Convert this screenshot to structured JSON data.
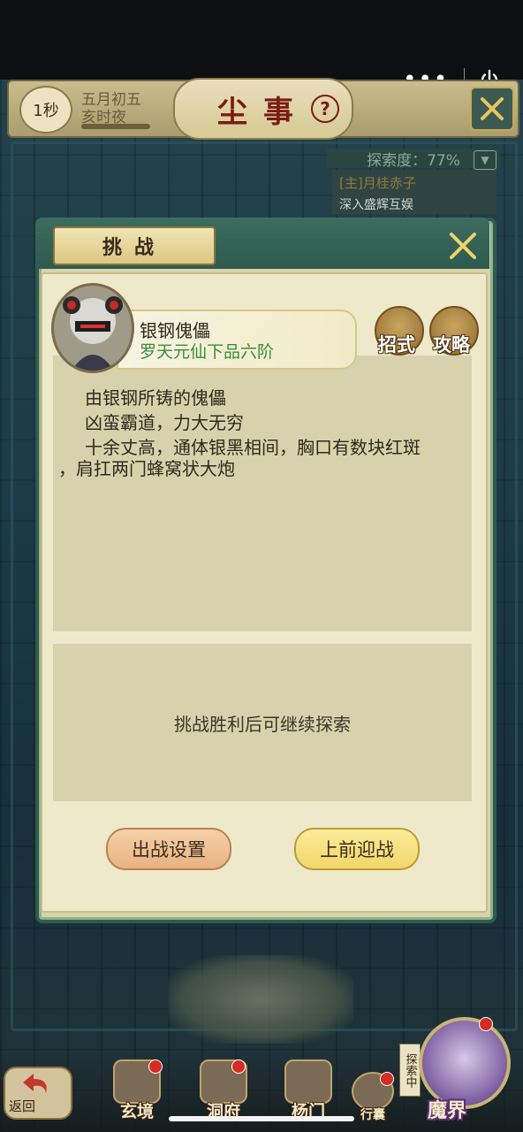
{
  "capsule": {
    "more_icon": "more-dots-icon",
    "power_icon": "power-icon"
  },
  "header": {
    "timer": "1秒",
    "date_line1": "五月初五",
    "date_line2": "亥时夜",
    "title": "尘事",
    "help": "?"
  },
  "explore": {
    "progress_text": "探索度：77%",
    "progress_value": 77
  },
  "quest": {
    "title": "[主]月桂赤子",
    "subtitle": "深入盛辉互娱"
  },
  "modal": {
    "title": "挑战",
    "enemy": {
      "name": "银钢傀儡",
      "rank": "罗天元仙下品六阶"
    },
    "buttons": {
      "moves": "招式",
      "guide": "攻略"
    },
    "description": [
      "由银钢所铸的傀儡",
      "凶蛮霸道，力大无穷",
      "十余丈高，通体银黑相间，胸口有数块红斑",
      "，肩扛两门蜂窝状大炮"
    ],
    "hint": "挑战胜利后可继续探索",
    "actions": {
      "setup": "出战设置",
      "fight": "上前迎战"
    }
  },
  "nav": {
    "back": "返回",
    "items": [
      "玄境",
      "洞府",
      "杨门",
      "行囊"
    ],
    "explore_tag": "探索中",
    "mojie": "魔界"
  },
  "colors": {
    "rank_green": "#3a8d3a",
    "modal_green": "#2f5a50",
    "title_red": "#7a1c14"
  }
}
